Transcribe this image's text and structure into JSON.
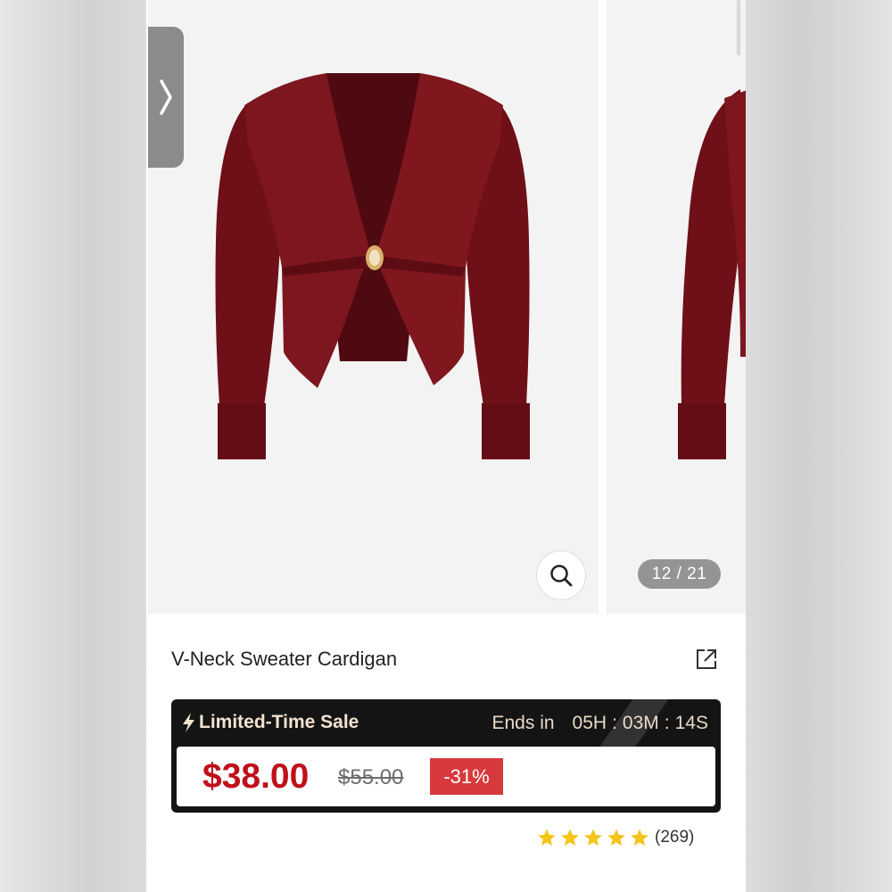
{
  "gallery": {
    "current_index": "12 / 21",
    "product_color": "#7e1620"
  },
  "product": {
    "title": "V-Neck Sweater Cardigan"
  },
  "sale": {
    "label": "Limited-Time Sale",
    "ends_label": "Ends in",
    "hours": "05H",
    "minutes": "03M",
    "seconds": "14S",
    "separator": ":",
    "price": "$38.00",
    "original_price": "$55.00",
    "discount": "-31%"
  },
  "rating": {
    "stars": 5,
    "max_stars": 5,
    "count": "(269)"
  },
  "icons": {
    "prev": "chevron-right-icon",
    "zoom": "magnifier-icon",
    "share": "share-icon",
    "sale": "lightning-icon",
    "rating": "star-icon"
  },
  "colors": {
    "price": "#c0101b",
    "discount_badge": "#d8393c",
    "sale_banner": "#141414",
    "star": "#f5c518"
  }
}
